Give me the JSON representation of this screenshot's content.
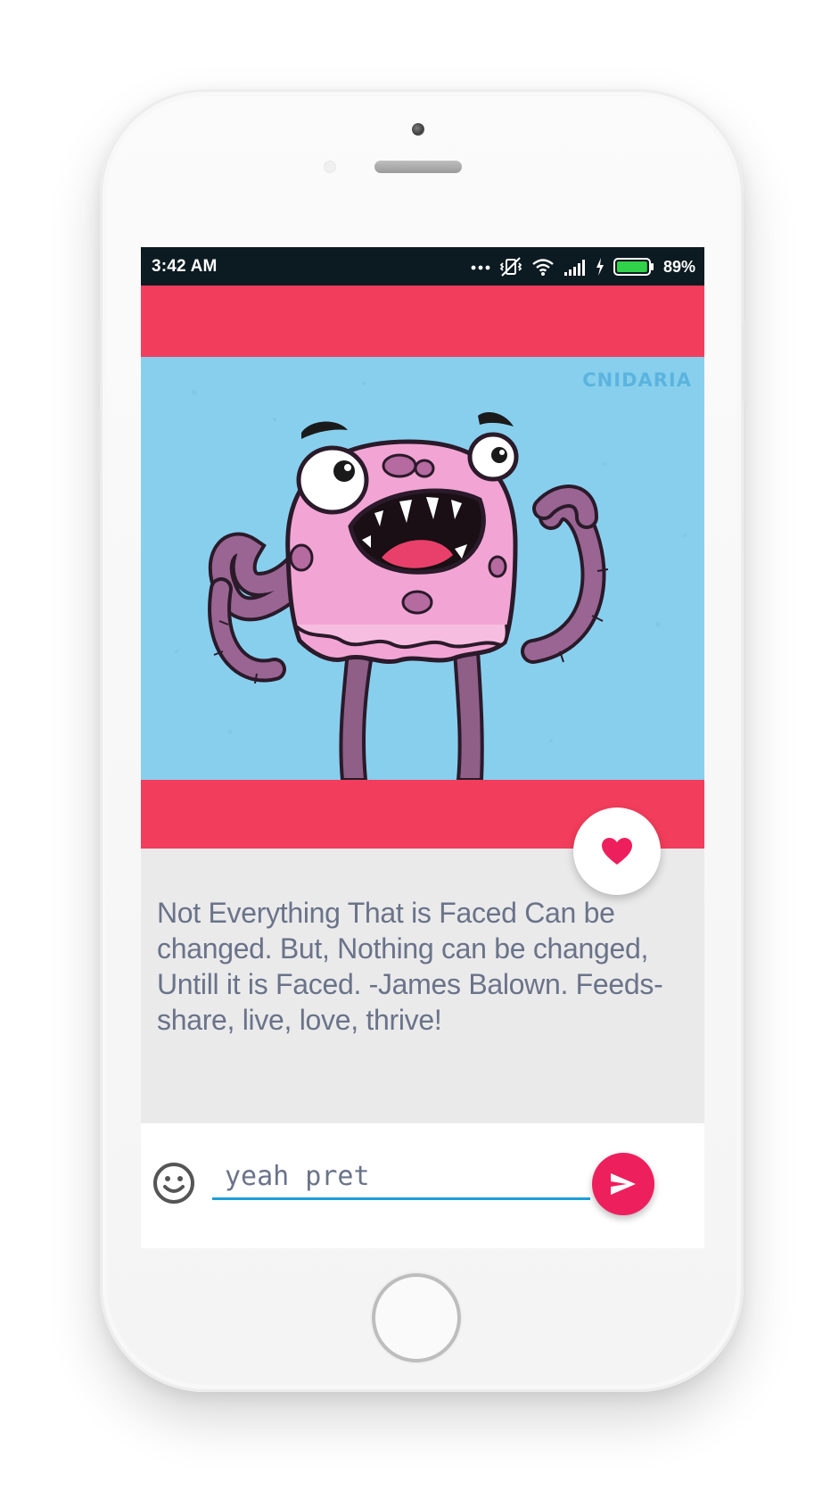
{
  "status_bar": {
    "time": "3:42 AM",
    "battery_percent": "89%",
    "battery_level": 0.89,
    "icons": [
      "more-dots-icon",
      "vibrate-off-icon",
      "wifi-icon",
      "signal-icon",
      "charging-bolt-icon",
      "battery-icon"
    ]
  },
  "post": {
    "image_watermark": "CNIDARIA",
    "caption": "Not Everything That is Faced Can be changed. But, Nothing can be changed, Untill it is Faced. -James Balown. Feeds- share, live, love, thrive!",
    "like_icon": "heart-icon"
  },
  "composer": {
    "emoji_icon": "emoji-icon",
    "input_value": "yeah pret",
    "send_icon": "send-icon"
  },
  "colors": {
    "status_bar_bg": "#0c1a21",
    "accent_red": "#f33d5c",
    "send_pink": "#ee1f5d",
    "image_bg": "#88cfee",
    "caption_bg": "#eaeaeb",
    "caption_text": "#6a7389",
    "input_underline": "#1d9fd7",
    "battery_green": "#30d24a"
  }
}
